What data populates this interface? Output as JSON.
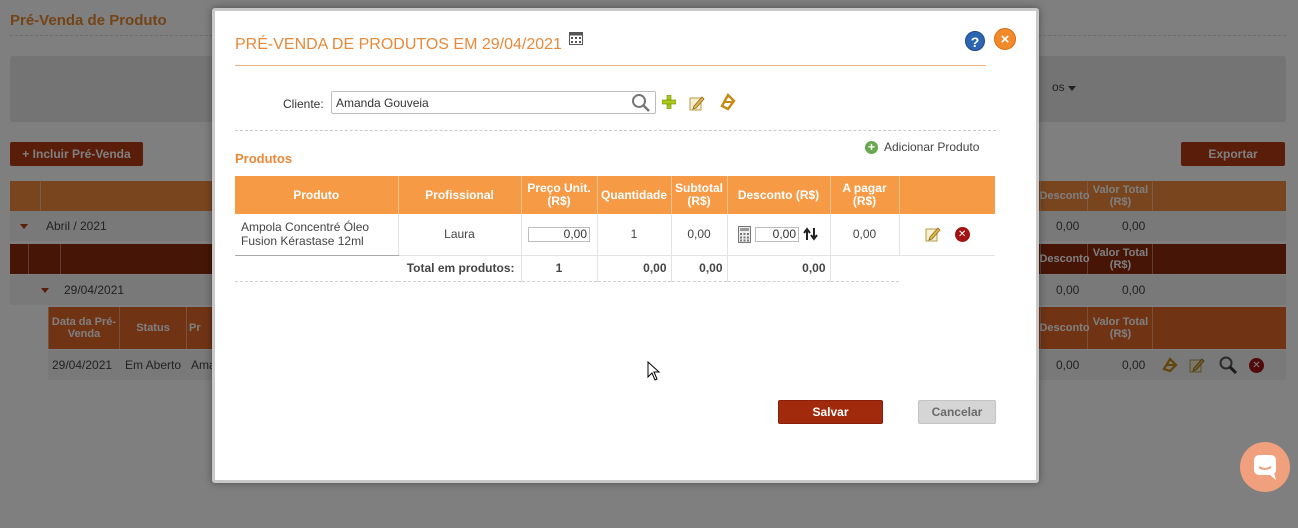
{
  "background": {
    "page_title": "Pré-Venda de Produto",
    "filter_button_fragment": "os",
    "include_button": "Incluir Pré-Venda",
    "export_button": "Exportar",
    "month_row": {
      "label": "Abril / 2021",
      "desconto": "0,00",
      "valor_total": "0,00"
    },
    "day_row": {
      "label": "29/04/2021",
      "desconto": "0,00",
      "valor_total": "0,00"
    },
    "header_desconto": "Desconto",
    "header_valor_total": "Valor Total (R$)",
    "detail_headers": {
      "data": "Data da Pré-Venda",
      "status": "Status",
      "p": "Pr"
    },
    "detail_row": {
      "data": "29/04/2021",
      "status": "Em Aberto",
      "cliente": "Ama",
      "desconto": "0,00",
      "valor_total": "0,00"
    }
  },
  "modal": {
    "title": "PRÉ-VENDA DE PRODUTOS EM 29/04/2021",
    "help": "?",
    "close": "×",
    "client_label": "Cliente:",
    "client_value": "Amanda Gouveia",
    "add_product": "Adicionar Produto",
    "add_product_plus": "+",
    "products_title": "Produtos",
    "table": {
      "headers": [
        "Produto",
        "Profissional",
        "Preço Unit. (R$)",
        "Quantidade",
        "Subtotal (R$)",
        "Desconto (R$)",
        "A pagar (R$)",
        ""
      ],
      "row": {
        "produto": "Ampola Concentré Óleo Fusion Kérastase 12ml",
        "profissional": "Laura",
        "preco": "0,00",
        "quantidade": "1",
        "subtotal": "0,00",
        "desconto": "0,00",
        "a_pagar": "0,00"
      },
      "total": {
        "label": "Total em produtos:",
        "quantidade": "1",
        "subtotal": "0,00",
        "desconto": "0,00",
        "a_pagar": "0,00"
      }
    },
    "save_button": "Salvar",
    "cancel_button": "Cancelar",
    "remove_glyph": "✕"
  },
  "colors": {
    "accent_orange": "#f69a45",
    "title_orange": "#e8893a",
    "dark_red": "#a12a0c"
  }
}
